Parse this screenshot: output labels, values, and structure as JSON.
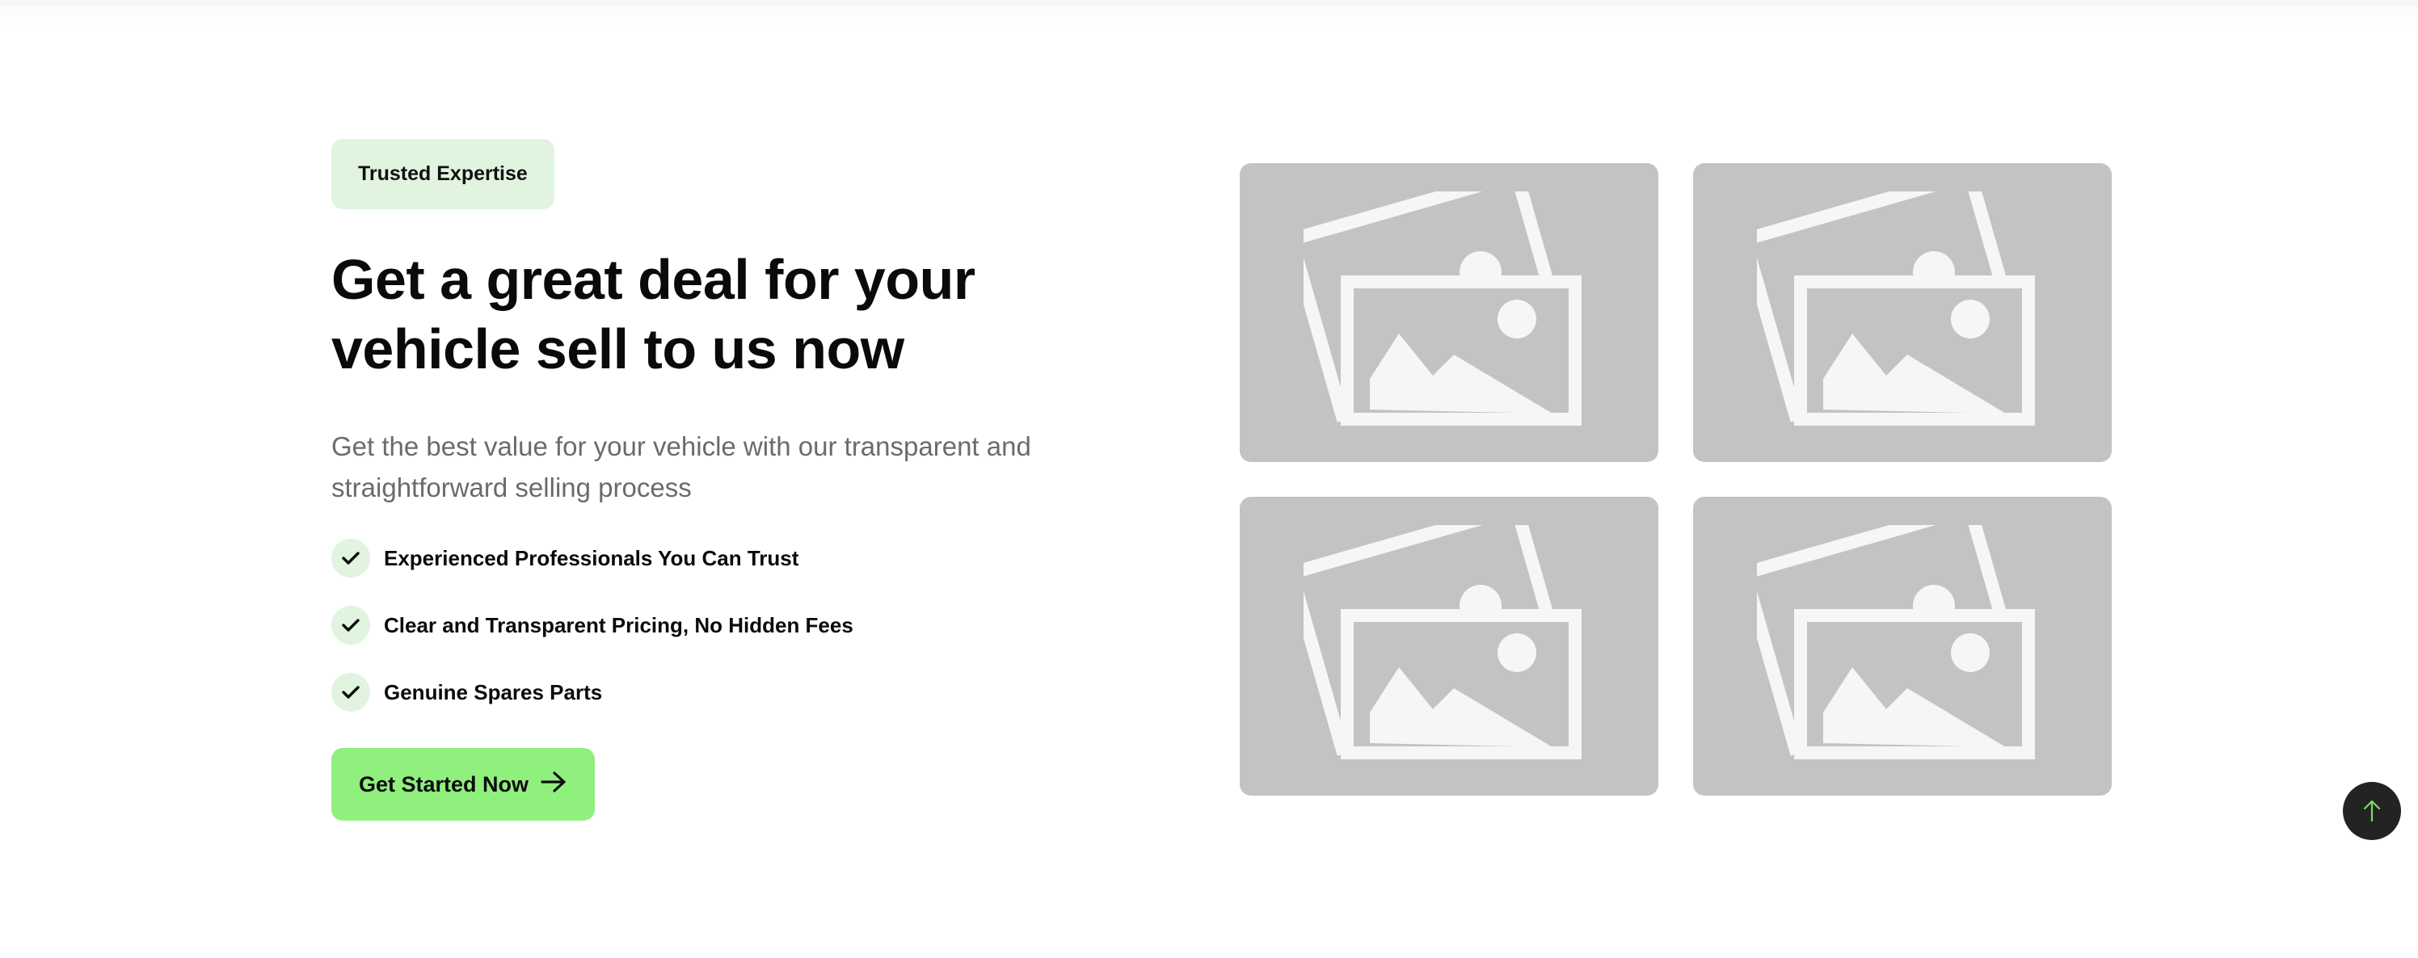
{
  "section": {
    "badge": "Trusted Expertise",
    "heading": "Get a great deal for your vehicle sell to us now",
    "subtext": "Get the best value for your vehicle with our transparent and straightforward selling process",
    "features": [
      {
        "label": "Experienced Professionals You Can Trust",
        "icon": "check-icon"
      },
      {
        "label": "Clear and Transparent Pricing, No Hidden Fees",
        "icon": "check-icon"
      },
      {
        "label": "Genuine Spares Parts",
        "icon": "check-icon"
      }
    ],
    "cta": {
      "label": "Get Started Now",
      "icon": "arrow-right-icon"
    }
  },
  "gallery": {
    "images": [
      {
        "icon": "image-placeholder-icon"
      },
      {
        "icon": "image-placeholder-icon"
      },
      {
        "icon": "image-placeholder-icon"
      },
      {
        "icon": "image-placeholder-icon"
      }
    ]
  },
  "back_to_top": {
    "icon": "arrow-up-icon"
  },
  "colors": {
    "accent": "#8ff07e",
    "badge_bg": "#e0f4e0",
    "placeholder_bg": "#c4c3c4",
    "placeholder_fg": "#f7f6f5",
    "back_to_top_bg": "#232323",
    "back_to_top_arrow": "#7fd96b"
  }
}
